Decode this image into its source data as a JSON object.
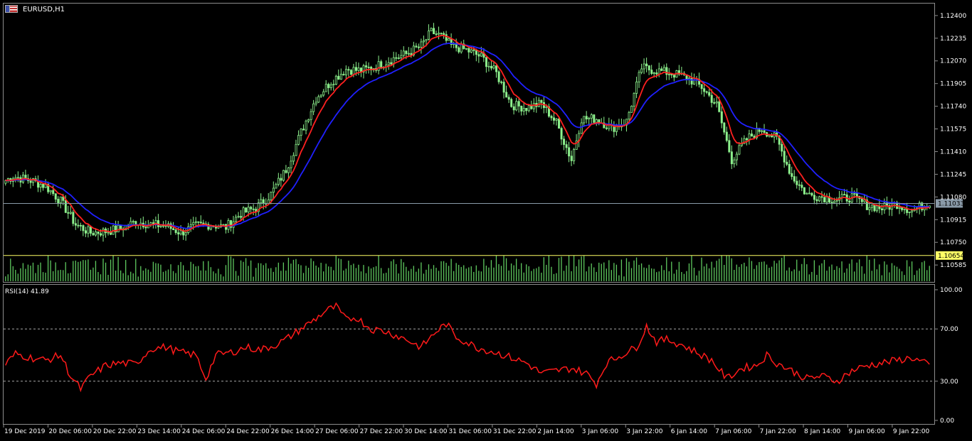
{
  "window": {
    "symbol_label": "EURUSD,H1",
    "rsi_label": "RSI(14) 41.89"
  },
  "colors": {
    "bull_candle": "#8cf08c",
    "bear_candle": "#8cf08c",
    "ma_fast": "#ff2020",
    "ma_slow": "#2020ff",
    "rsi_line": "#ff1a1a",
    "bid_line": "#8a9aa8",
    "level_line": "#ffff66",
    "volume": "#5ec85e"
  },
  "chart_data": [
    {
      "type": "candlestick",
      "name": "EURUSD,H1",
      "title": "EURUSD,H1",
      "ylim": [
        1.1056,
        1.1242
      ],
      "y_ticks": [
        "1.12400",
        "1.12235",
        "1.12070",
        "1.11905",
        "1.11740",
        "1.11575",
        "1.11410",
        "1.11245",
        "1.11080",
        "1.10915",
        "1.10750",
        "1.10585"
      ],
      "x_ticks": [
        "19 Dec 2019",
        "20 Dec 06:00",
        "20 Dec 22:00",
        "23 Dec 14:00",
        "24 Dec 06:00",
        "24 Dec 22:00",
        "26 Dec 14:00",
        "27 Dec 06:00",
        "27 Dec 22:00",
        "30 Dec 14:00",
        "31 Dec 06:00",
        "31 Dec 22:00",
        "2 Jan 14:00",
        "3 Jan 06:00",
        "3 Jan 22:00",
        "6 Jan 14:00",
        "7 Jan 06:00",
        "7 Jan 22:00",
        "8 Jan 14:00",
        "9 Jan 06:00",
        "9 Jan 22:00"
      ],
      "price_anchors": [
        [
          0,
          1.112
        ],
        [
          3,
          1.1123
        ],
        [
          10,
          1.112
        ],
        [
          16,
          1.1116
        ],
        [
          22,
          1.1105
        ],
        [
          28,
          1.1088
        ],
        [
          34,
          1.1082
        ],
        [
          40,
          1.1083
        ],
        [
          46,
          1.1085
        ],
        [
          52,
          1.109
        ],
        [
          58,
          1.1088
        ],
        [
          64,
          1.1087
        ],
        [
          70,
          1.1082
        ],
        [
          76,
          1.1087
        ],
        [
          82,
          1.1088
        ],
        [
          88,
          1.1086
        ],
        [
          94,
          1.1096
        ],
        [
          100,
          1.11
        ],
        [
          106,
          1.111
        ],
        [
          112,
          1.1128
        ],
        [
          118,
          1.1155
        ],
        [
          124,
          1.118
        ],
        [
          130,
          1.1192
        ],
        [
          136,
          1.1201
        ],
        [
          142,
          1.12
        ],
        [
          148,
          1.1203
        ],
        [
          154,
          1.1208
        ],
        [
          160,
          1.1212
        ],
        [
          166,
          1.1218
        ],
        [
          170,
          1.1228
        ],
        [
          174,
          1.1225
        ],
        [
          178,
          1.1218
        ],
        [
          184,
          1.1215
        ],
        [
          190,
          1.121
        ],
        [
          196,
          1.1198
        ],
        [
          202,
          1.1175
        ],
        [
          208,
          1.1173
        ],
        [
          214,
          1.1176
        ],
        [
          220,
          1.1162
        ],
        [
          226,
          1.1135
        ],
        [
          230,
          1.1165
        ],
        [
          236,
          1.1165
        ],
        [
          242,
          1.1158
        ],
        [
          248,
          1.1163
        ],
        [
          254,
          1.1202
        ],
        [
          260,
          1.12
        ],
        [
          266,
          1.1198
        ],
        [
          272,
          1.1195
        ],
        [
          278,
          1.1188
        ],
        [
          284,
          1.1175
        ],
        [
          290,
          1.1135
        ],
        [
          296,
          1.115
        ],
        [
          302,
          1.1158
        ],
        [
          308,
          1.115
        ],
        [
          314,
          1.1123
        ],
        [
          320,
          1.111
        ],
        [
          326,
          1.1108
        ],
        [
          332,
          1.1106
        ],
        [
          338,
          1.1108
        ],
        [
          344,
          1.1102
        ],
        [
          350,
          1.11
        ],
        [
          356,
          1.1103
        ],
        [
          362,
          1.1098
        ],
        [
          369,
          1.1104
        ]
      ],
      "ma_fast_period": 8,
      "ma_slow_period": 21,
      "bid_price": "1.11033",
      "level_price": "1.10654"
    },
    {
      "type": "line",
      "name": "RSI(14)",
      "title": "RSI(14) 41.89",
      "ylim": [
        0,
        100
      ],
      "y_ticks": [
        "100.00",
        "70.00",
        "30.00",
        "0.00"
      ],
      "levels": [
        70,
        30
      ],
      "rsi_anchors": [
        [
          0,
          43
        ],
        [
          4,
          51
        ],
        [
          10,
          48
        ],
        [
          16,
          46
        ],
        [
          22,
          50
        ],
        [
          26,
          34
        ],
        [
          30,
          24
        ],
        [
          34,
          34
        ],
        [
          40,
          42
        ],
        [
          46,
          44
        ],
        [
          52,
          43
        ],
        [
          58,
          55
        ],
        [
          64,
          56
        ],
        [
          70,
          52
        ],
        [
          76,
          50
        ],
        [
          80,
          32
        ],
        [
          84,
          50
        ],
        [
          90,
          52
        ],
        [
          96,
          56
        ],
        [
          102,
          54
        ],
        [
          108,
          58
        ],
        [
          112,
          62
        ],
        [
          118,
          70
        ],
        [
          124,
          78
        ],
        [
          128,
          84
        ],
        [
          132,
          87
        ],
        [
          136,
          77
        ],
        [
          140,
          79
        ],
        [
          146,
          70
        ],
        [
          152,
          68
        ],
        [
          160,
          62
        ],
        [
          166,
          56
        ],
        [
          172,
          68
        ],
        [
          176,
          74
        ],
        [
          180,
          64
        ],
        [
          188,
          56
        ],
        [
          196,
          52
        ],
        [
          202,
          48
        ],
        [
          208,
          44
        ],
        [
          214,
          36
        ],
        [
          220,
          38
        ],
        [
          226,
          40
        ],
        [
          232,
          36
        ],
        [
          236,
          28
        ],
        [
          240,
          44
        ],
        [
          246,
          50
        ],
        [
          252,
          56
        ],
        [
          256,
          72
        ],
        [
          260,
          60
        ],
        [
          264,
          62
        ],
        [
          270,
          58
        ],
        [
          276,
          52
        ],
        [
          282,
          46
        ],
        [
          288,
          32
        ],
        [
          294,
          40
        ],
        [
          300,
          42
        ],
        [
          304,
          50
        ],
        [
          308,
          44
        ],
        [
          314,
          38
        ],
        [
          320,
          32
        ],
        [
          326,
          34
        ],
        [
          332,
          30
        ],
        [
          338,
          38
        ],
        [
          344,
          42
        ],
        [
          350,
          44
        ],
        [
          356,
          46
        ],
        [
          362,
          48
        ],
        [
          369,
          42
        ]
      ]
    }
  ]
}
